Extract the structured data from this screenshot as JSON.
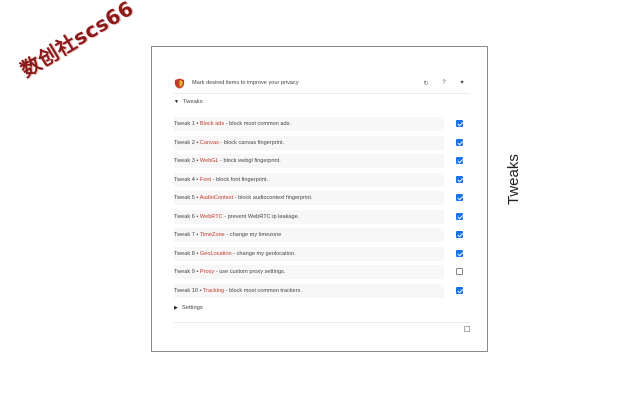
{
  "watermark": "数创社scs66",
  "side_title": "Tweaks",
  "header": {
    "text": "Mark desired items to improve your privacy",
    "icons": [
      "reload-icon",
      "help-icon",
      "heart-icon"
    ],
    "reload_glyph": "↻",
    "help_glyph": "?",
    "heart_glyph": "♥"
  },
  "tweaks_section": {
    "label": "Tweaks",
    "expanded": true,
    "arrow": "▼"
  },
  "tweaks": [
    {
      "prefix": "Tweak 1 • ",
      "feature": "Block ads",
      "desc": " - block most common ads.",
      "checked": true
    },
    {
      "prefix": "Tweak 2 • ",
      "feature": "Canvas",
      "desc": " - block canvas fingerprint.",
      "checked": true
    },
    {
      "prefix": "Tweak 3 • ",
      "feature": "WebGL",
      "desc": " - block webgl fingerprint.",
      "checked": true
    },
    {
      "prefix": "Tweak 4 • ",
      "feature": "Font",
      "desc": " - block font fingerprint.",
      "checked": true
    },
    {
      "prefix": "Tweak 5 • ",
      "feature": "AudioContext",
      "desc": " - block audiocontext fingerprint.",
      "checked": true
    },
    {
      "prefix": "Tweak 6 • ",
      "feature": "WebRTC",
      "desc": " - prevent WebRTC ip leakage.",
      "checked": true
    },
    {
      "prefix": "Tweak 7 • ",
      "feature": "TimeZone",
      "desc": " - change my timezone",
      "checked": true
    },
    {
      "prefix": "Tweak 8 • ",
      "feature": "GeoLocation",
      "desc": " - change my geolocation.",
      "checked": true
    },
    {
      "prefix": "Tweak 9 • ",
      "feature": "Proxy",
      "desc": " - use custom proxy settings.",
      "checked": false
    },
    {
      "prefix": "Tweak 10 • ",
      "feature": "Tracking",
      "desc": " - block most common trackers.",
      "checked": true
    }
  ],
  "settings_section": {
    "label": "Settings",
    "expanded": false,
    "arrow": "▶"
  },
  "colors": {
    "accent": "#1a73e8",
    "feature": "#c0392b",
    "logo_red": "#c0392b"
  }
}
